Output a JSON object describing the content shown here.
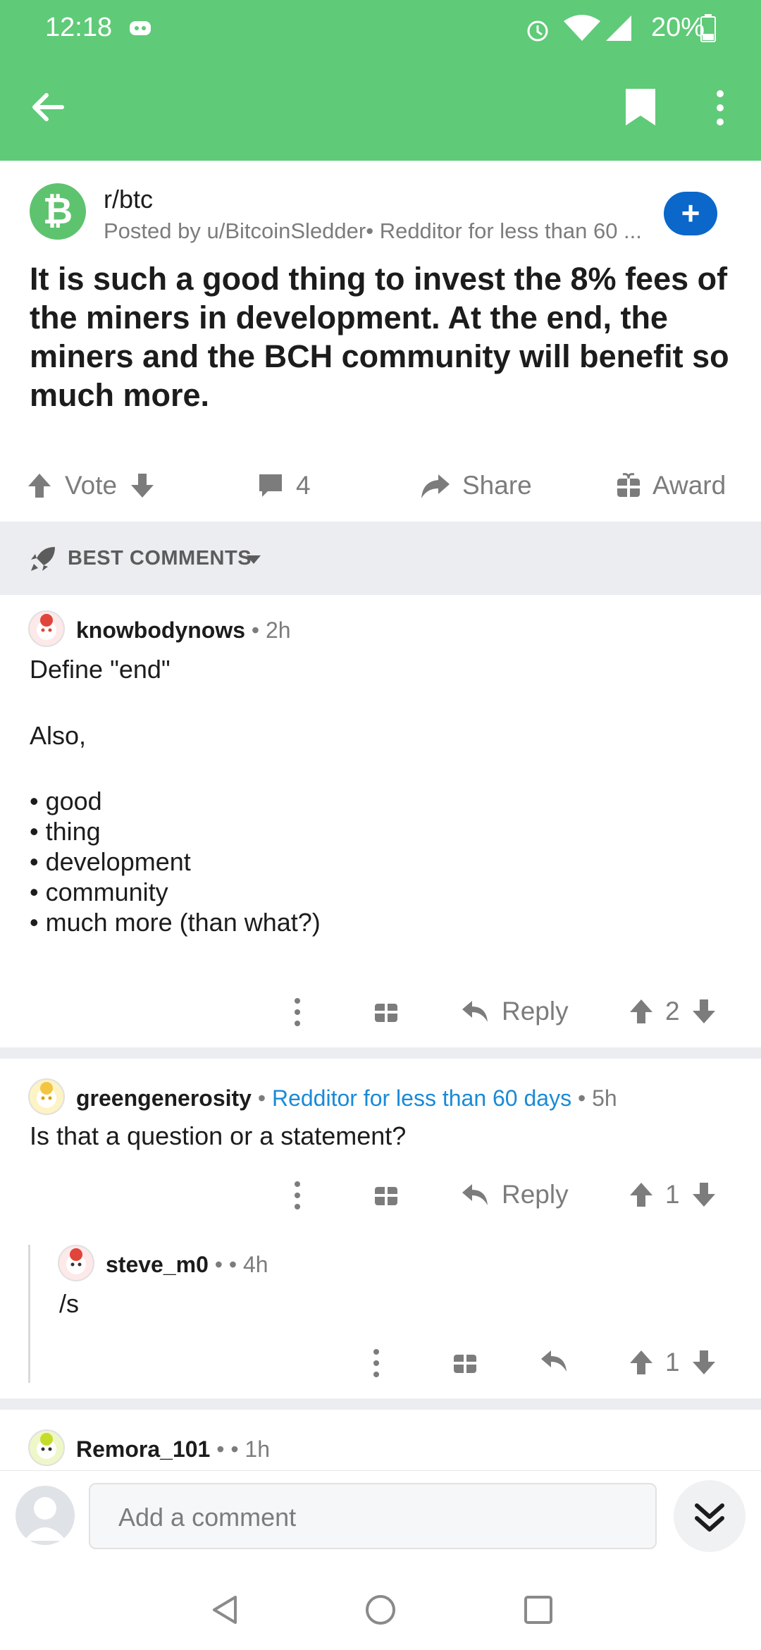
{
  "status_bar": {
    "time": "12:18",
    "battery": "20%"
  },
  "post": {
    "subreddit": "r/btc",
    "posted_by": "Posted by u/BitcoinSledder• Redditor for less than 60 ...",
    "join_label": "+",
    "title": "It is such a good thing to invest the 8% fees of the miners in development. At the end, the miners and the BCH community will benefit so much more.",
    "vote_label": "Vote",
    "comment_count": "4",
    "share_label": "Share",
    "award_label": "Award"
  },
  "sort": {
    "label": "BEST COMMENTS"
  },
  "comments": [
    {
      "author": "knowbodynows",
      "meta": " • 2h",
      "line1": "Define \"end\"",
      "line2": "Also,",
      "bullets": [
        "good",
        "thing",
        "development",
        "community",
        "much more (than what?)"
      ],
      "reply_label": "Reply",
      "score": "2"
    },
    {
      "author": "greengenerosity",
      "flair": "Redditor for less than 60 days",
      "meta": " • 5h",
      "body": "Is that a question or a statement?",
      "reply_label": "Reply",
      "score": "1"
    },
    {
      "author": "steve_m0",
      "meta": " •  • 4h",
      "body": "/s",
      "score": "1"
    },
    {
      "author": "Remora_101",
      "meta": " •  • 1h"
    }
  ],
  "composer": {
    "placeholder": "Add a comment"
  },
  "colors": {
    "app_bar": "#5fca78",
    "join_button": "#0b67c9",
    "flair": "#1a8ad8"
  },
  "icons": [
    "back-arrow-icon",
    "bookmark-icon",
    "overflow-menu-icon",
    "upvote-icon",
    "downvote-icon",
    "comment-icon",
    "share-icon",
    "award-icon",
    "rocket-icon",
    "reply-icon",
    "collapse-icon"
  ]
}
